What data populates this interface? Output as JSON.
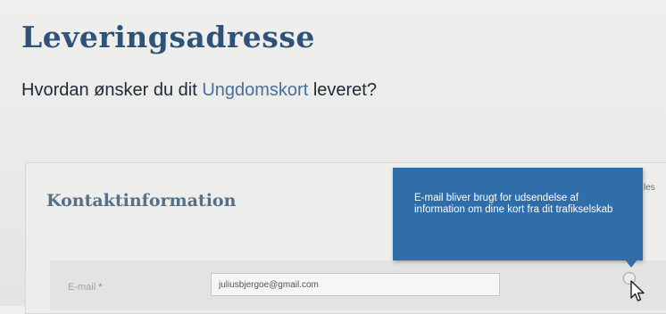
{
  "header": {
    "title": "Leveringsadresse",
    "question_prefix": "Hvordan ønsker du dit ",
    "question_highlight": "Ungdomskort",
    "question_suffix": " leveret?"
  },
  "contact_section": {
    "title": "Kontaktinformation",
    "clipped_side_text": "les",
    "email": {
      "label": "E-mail",
      "required_marker": "*",
      "value": "juliusbjergoe@gmail.com"
    }
  },
  "tooltip": {
    "text": "E-mail bliver brugt for udsendelse af information om dine kort fra dit trafikselskab"
  },
  "icons": {
    "info": "info-circle-icon",
    "cursor": "mouse-cursor-icon"
  },
  "colors": {
    "title": "#2f5378",
    "highlight": "#4a6f9a",
    "tooltip_bg": "#2f6ea9",
    "section_title": "#566f88"
  }
}
